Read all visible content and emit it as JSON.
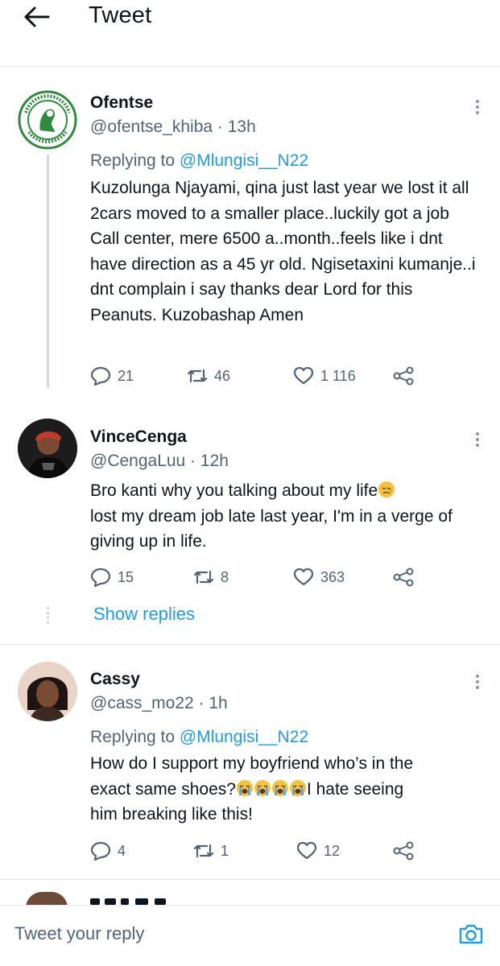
{
  "header": {
    "title": "Tweet"
  },
  "tweets": [
    {
      "name": "Ofentse",
      "handle_time": "@ofentse_khiba · 13h",
      "replying_prefix": "Replying to",
      "replying_to": "@Mlungisi__N22",
      "text": "Kuzolunga Njayami, qina just last year we lost it all 2cars moved to a smaller place..luckily got a job Call center, mere 6500 a..month..feels like i dnt have direction as a 45 yr old. Ngisetaxini kumanje..i dnt complain i say thanks dear Lord for this Peanuts. Kuzobashap Amen",
      "replies": "21",
      "retweets": "46",
      "likes": "1 116",
      "avatar_badge_text": "BLOEMFONTEIN CELTIC FOOTBALL CLUB"
    },
    {
      "name": "VinceCenga",
      "handle_time": "@CengaLuu · 12h",
      "text_line1": "Bro kanti why you talking about my life",
      "emoji": "disappointed-relieved-face",
      "text_rest": "lost my dream job late last year, I'm in a verge of giving up in life.",
      "replies": "15",
      "retweets": "8",
      "likes": "363",
      "show_replies": "Show replies"
    },
    {
      "name": "Cassy",
      "handle_time": "@cass_mo22 · 1h",
      "replying_prefix": "Replying to",
      "replying_to": "@Mlungisi__N22",
      "text_line1": "How do I support my boyfriend who’s in the",
      "text_line2_before": "exact same shoes?",
      "emoji": "loudly-crying-face",
      "emoji_count": 4,
      "text_line2_after": "I hate seeing",
      "text_line3": "him breaking like this!",
      "replies": "4",
      "retweets": "1",
      "likes": "12"
    }
  ],
  "compose": {
    "placeholder": "Tweet your reply"
  },
  "colors": {
    "accent": "#1d9bf0",
    "secondary_text": "#536471",
    "primary_text": "#0f1419",
    "divider": "#e4e8eb",
    "celtic_green": "#2e8b3e"
  }
}
